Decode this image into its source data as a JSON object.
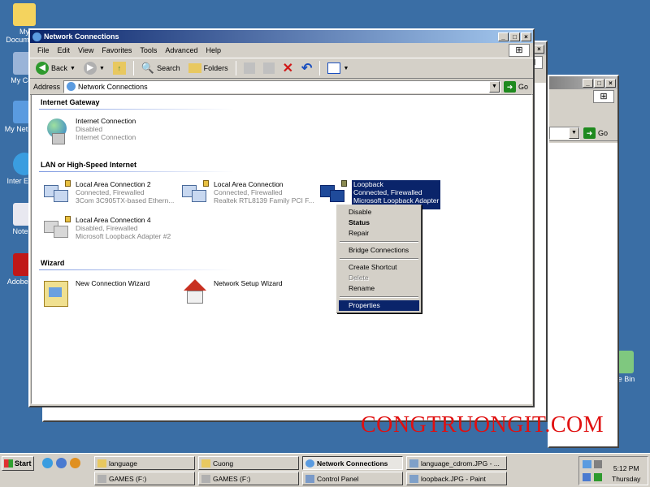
{
  "desktop": {
    "icons": [
      {
        "label": "My Documents"
      },
      {
        "label": "My Com"
      },
      {
        "label": "My Net Plac"
      },
      {
        "label": "Inter Explo"
      },
      {
        "label": "Notepa"
      },
      {
        "label": "Adobe R 8"
      },
      {
        "label": "le Bin"
      }
    ]
  },
  "window": {
    "title": "Network Connections",
    "menu": [
      "File",
      "Edit",
      "View",
      "Favorites",
      "Tools",
      "Advanced",
      "Help"
    ],
    "toolbar": {
      "back": "Back",
      "search": "Search",
      "folders": "Folders"
    },
    "address": {
      "label": "Address",
      "value": "Network Connections",
      "go": "Go"
    }
  },
  "bg_window": {
    "go": "Go"
  },
  "groups": [
    {
      "heading": "Internet Gateway"
    },
    {
      "heading": "LAN or High-Speed Internet"
    },
    {
      "heading": "Wizard"
    }
  ],
  "connections": [
    {
      "name": "Internet Connection",
      "status": "Disabled",
      "device": "Internet Connection"
    },
    {
      "name": "Local Area Connection 2",
      "status": "Connected, Firewalled",
      "device": "3Com 3C905TX-based Ethern..."
    },
    {
      "name": "Local Area Connection",
      "status": "Connected, Firewalled",
      "device": "Realtek RTL8139 Family PCI F..."
    },
    {
      "name": "Loopback",
      "status": "Connected, Firewalled",
      "device": "Microsoft Loopback Adapter"
    },
    {
      "name": "Local Area Connection 4",
      "status": "Disabled, Firewalled",
      "device": "Microsoft Loopback Adapter #2"
    }
  ],
  "wizards": [
    {
      "name": "New Connection Wizard"
    },
    {
      "name": "Network Setup Wizard"
    }
  ],
  "context_menu": {
    "disable": "Disable",
    "status": "Status",
    "repair": "Repair",
    "bridge": "Bridge Connections",
    "shortcut": "Create Shortcut",
    "delete": "Delete",
    "rename": "Rename",
    "properties": "Properties"
  },
  "watermark": "CONGTRUONGIT.COM",
  "taskbar": {
    "start": "Start",
    "tasks": [
      {
        "label": "language"
      },
      {
        "label": "Cuong"
      },
      {
        "label": "Network Connections"
      },
      {
        "label": "language_cdrom.JPG - ..."
      },
      {
        "label": "GAMES (F:)"
      },
      {
        "label": "GAMES (F:)"
      },
      {
        "label": "Control Panel"
      },
      {
        "label": "loopback.JPG - Paint"
      }
    ],
    "time": "5:12 PM",
    "day": "Thursday"
  },
  "colors": {
    "desktop": "#3a6ea5",
    "titlebar": "#0a246a",
    "selection": "#0a246a",
    "watermark": "#e01010"
  }
}
